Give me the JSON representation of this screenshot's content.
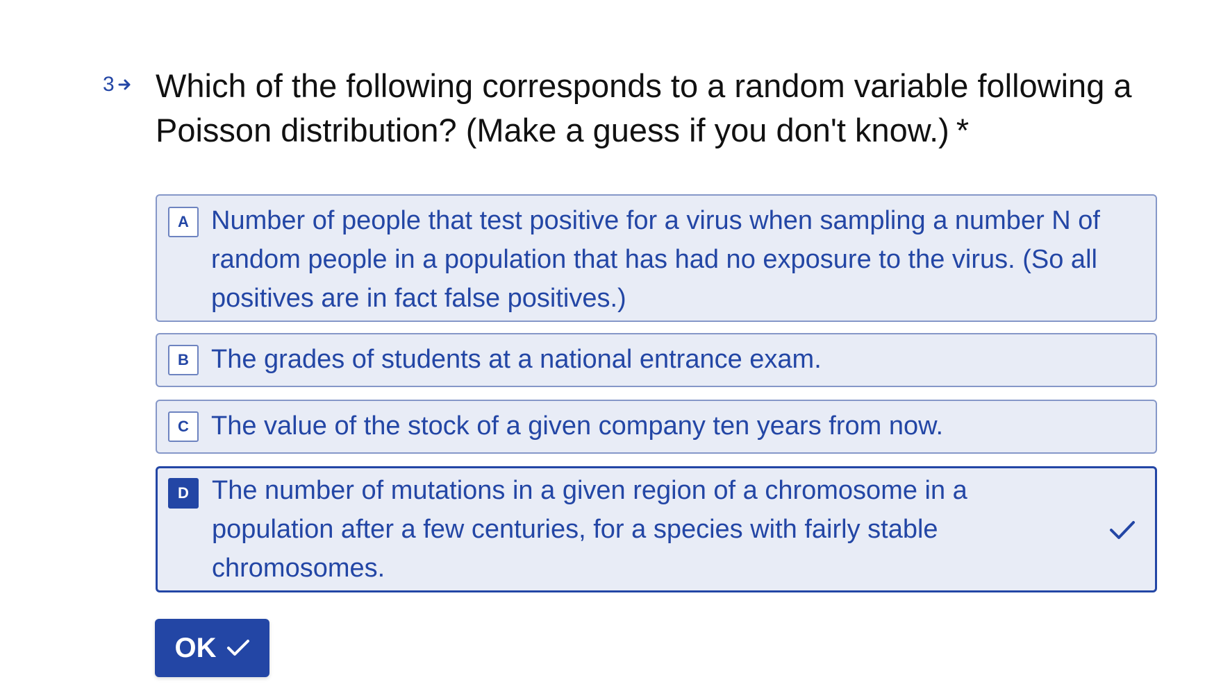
{
  "question": {
    "number": "3",
    "text": "Which of the following corresponds to a random variable following a Poisson distribution? (Make a guess if you don't know.)",
    "required_marker": "*"
  },
  "options": [
    {
      "key": "A",
      "text": "Number of people that test positive for a virus when sampling a number N of random people in a population that has had no exposure to the virus. (So all positives are in fact false positives.)",
      "selected": false
    },
    {
      "key": "B",
      "text": "The grades of students at a national entrance exam.",
      "selected": false
    },
    {
      "key": "C",
      "text": "The value of the stock of a given company ten years from now.",
      "selected": false
    },
    {
      "key": "D",
      "text": "The number of mutations in a given region of a chromosome in a population after a few centuries, for a species with fairly stable chromosomes.",
      "selected": true
    }
  ],
  "submit": {
    "label": "OK"
  },
  "colors": {
    "accent": "#2346a5",
    "option_background": "#e8ecf6",
    "option_border": "#8597c8",
    "text": "#111111"
  },
  "icons": {
    "question_arrow": "arrow-right-icon",
    "selected_check": "checkmark-icon",
    "submit_check": "checkmark-icon"
  }
}
